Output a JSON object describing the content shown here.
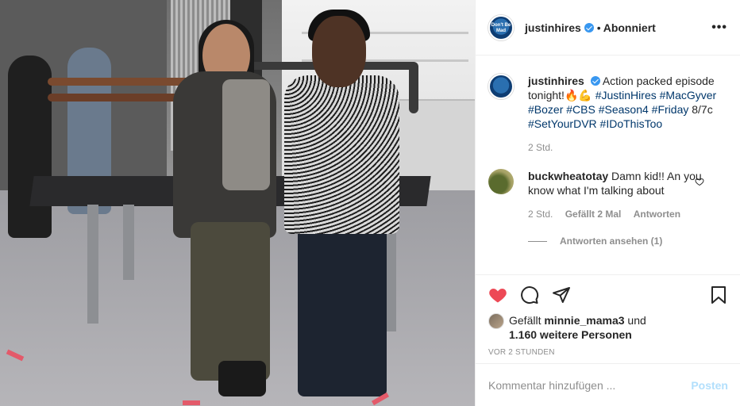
{
  "post": {
    "username": "justinhires",
    "separator": "•",
    "follow_state": "Abonniert",
    "more": "•••",
    "caption": {
      "prefix": "Action packed episode tonight!",
      "emoji": "🔥💪",
      "tags": [
        "#JustinHires",
        "#MacGyver",
        "#Bozer",
        "#CBS",
        "#Season4",
        "#Friday"
      ],
      "time_text": "8/7c",
      "tags2": [
        "#SetYourDVR",
        "#IDoThisToo"
      ],
      "age": "2 Std."
    },
    "avatar_text": "Don't Be Mad"
  },
  "comments": [
    {
      "username": "buckwheatotay",
      "text": "Damn kid!! An you know what I'm talking about",
      "age": "2 Std.",
      "likes": "Gefällt 2 Mal",
      "reply": "Antworten",
      "view_replies": "Antworten ansehen (1)"
    }
  ],
  "actions": {
    "liked_by_prefix": "Gefällt",
    "liked_by_user": "minnie_mama3",
    "liked_by_and": "und",
    "others": "1.160 weitere Personen",
    "time_ago": "VOR 2 STUNDEN"
  },
  "add_comment": {
    "placeholder": "Kommentar hinzufügen ...",
    "post_label": "Posten"
  },
  "colors": {
    "like_red": "#ed4956",
    "link_blue": "#00376b",
    "verified_blue": "#3897f0",
    "post_disabled": "#b2dffc"
  }
}
